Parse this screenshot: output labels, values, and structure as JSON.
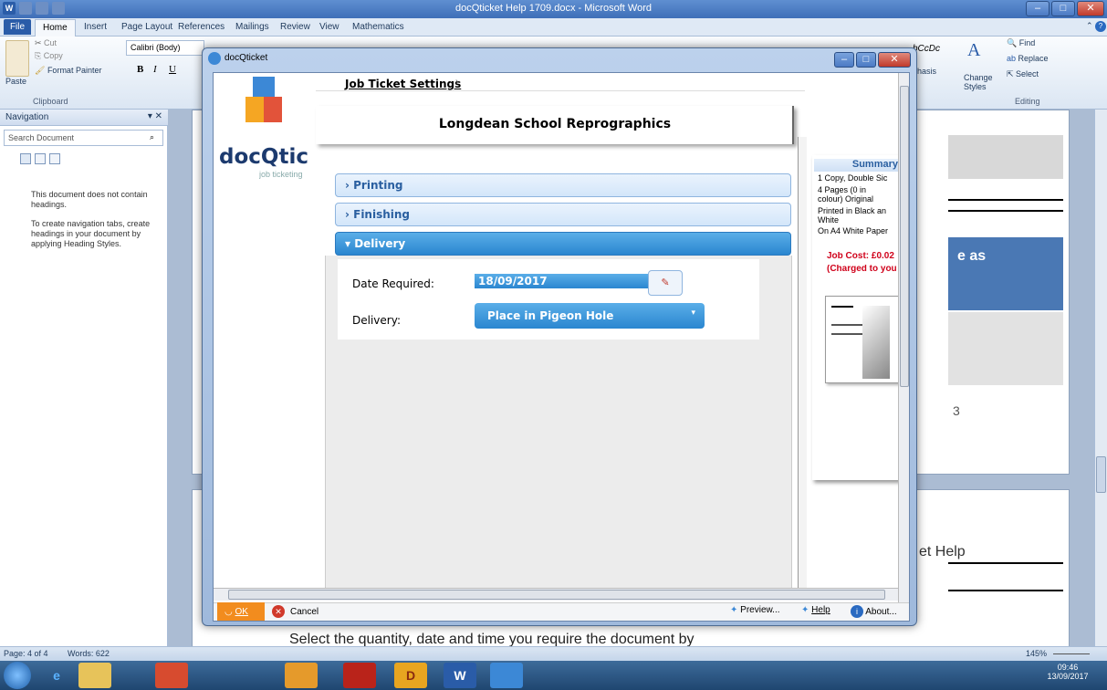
{
  "word": {
    "title": "docQticket Help 1709.docx - Microsoft Word",
    "tabs": [
      "File",
      "Home",
      "Insert",
      "Page Layout",
      "References",
      "Mailings",
      "Review",
      "View",
      "Mathematics"
    ],
    "clipboard": {
      "cut": "Cut",
      "copy": "Copy",
      "paste": "Paste",
      "format_painter": "Format Painter",
      "group_label": "Clipboard"
    },
    "font": {
      "name": "Calibri (Body)",
      "bold": "B",
      "italic": "I",
      "underline": "U"
    },
    "styles": {
      "style_sample": "bCcDc",
      "emphasis": "phasis",
      "change_styles": "Change Styles"
    },
    "editing": {
      "find": "Find",
      "replace": "Replace",
      "select": "Select",
      "group_label": "Editing"
    }
  },
  "navigation": {
    "title": "Navigation",
    "search_placeholder": "Search Document",
    "msg1": "This document does not contain headings.",
    "msg2": "To create navigation tabs, create headings in your document by applying Heading Styles."
  },
  "document": {
    "page_number": "3",
    "banner_text": "e as",
    "footer_partial": "et Help",
    "bottom_text": "Select the quantity, date and time you require the document by"
  },
  "status": {
    "page": "Page: 4 of 4",
    "words": "Words: 622",
    "zoom": "145%"
  },
  "taskbar": {
    "time": "09:46",
    "date": "13/09/2017"
  },
  "dialog": {
    "title": "docQticket",
    "header_link": "Job Ticket Settings",
    "logo_text": "docQtic",
    "logo_sub": "job ticketing",
    "org_name": "Longdean School Reprographics",
    "sections": [
      {
        "label": "Printing",
        "state": "collapsed"
      },
      {
        "label": "Finishing",
        "state": "collapsed"
      },
      {
        "label": "Delivery",
        "state": "expanded"
      }
    ],
    "delivery": {
      "date_label": "Date Required:",
      "date_value": "18/09/2017",
      "delivery_label": "Delivery:",
      "delivery_value": "Place in Pigeon Hole"
    },
    "summary": {
      "title": "Summary",
      "lines": [
        "1 Copy, Double Sic",
        "4 Pages (0 in",
        "colour) Original",
        "Printed in Black an",
        "White",
        "On A4 White Paper"
      ],
      "cost": "Job Cost: £0.02",
      "charged": "(Charged to you"
    },
    "buttons": {
      "ok": "OK",
      "cancel": "Cancel",
      "preview": "Preview...",
      "help": "Help",
      "about": "About..."
    }
  }
}
